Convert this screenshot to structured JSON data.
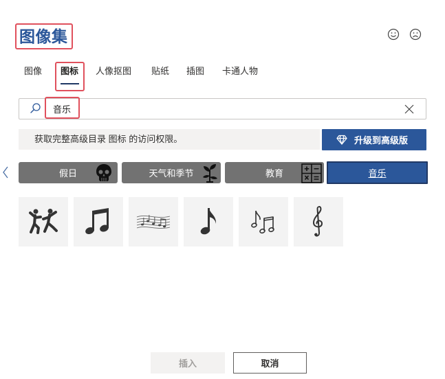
{
  "dialog": {
    "title": "图像集"
  },
  "feedback": {
    "smile_icon": "smile-icon",
    "frown_icon": "frown-icon"
  },
  "tabs": [
    {
      "label": "图像",
      "selected": false
    },
    {
      "label": "图标",
      "selected": true
    },
    {
      "label": "人像抠图",
      "selected": false
    },
    {
      "label": "贴纸",
      "selected": false
    },
    {
      "label": "插图",
      "selected": false
    },
    {
      "label": "卡通人物",
      "selected": false
    }
  ],
  "search": {
    "value": "音乐",
    "search_icon": "search-icon",
    "clear_icon": "close-icon"
  },
  "banner": {
    "text": "获取完整高级目录 图标 的访问权限。",
    "upgrade_label": "升级到高级版",
    "upgrade_icon": "diamond-icon"
  },
  "categories": {
    "prev_icon": "chevron-left-icon",
    "items": [
      {
        "label": "假日",
        "icon": "skull-icon",
        "selected": false
      },
      {
        "label": "天气和季节",
        "icon": "plant-icon",
        "selected": false
      },
      {
        "label": "教育",
        "icon": "calculator-icon",
        "selected": false
      },
      {
        "label": "音乐",
        "selected": true
      }
    ]
  },
  "results": [
    {
      "icon": "dancers-icon"
    },
    {
      "icon": "beamed-notes-icon"
    },
    {
      "icon": "music-staff-icon"
    },
    {
      "icon": "eighth-note-icon"
    },
    {
      "icon": "note-pair-icon"
    },
    {
      "icon": "treble-clef-icon"
    }
  ],
  "footer": {
    "insert_label": "插入",
    "insert_disabled": true,
    "cancel_label": "取消"
  },
  "colors": {
    "accent": "#2b579a",
    "highlight": "#e0505c",
    "category_bg": "#727272",
    "tile_bg": "#f3f3f3"
  }
}
